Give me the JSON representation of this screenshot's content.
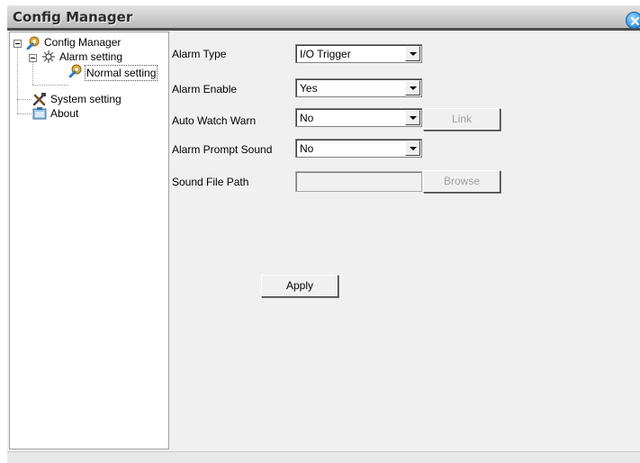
{
  "window": {
    "title": "Config Manager"
  },
  "tree": {
    "root": {
      "label": "Config Manager",
      "icon": "config-manager-icon"
    },
    "alarm_setting": {
      "label": "Alarm setting",
      "icon": "alarm-icon"
    },
    "normal_setting": {
      "label": "Normal setting",
      "icon": "config-gear-icon"
    },
    "system_setting": {
      "label": "System setting",
      "icon": "tools-icon"
    },
    "about": {
      "label": "About",
      "icon": "about-icon"
    }
  },
  "form": {
    "alarm_type": {
      "label": "Alarm Type",
      "value": "I/O Trigger"
    },
    "alarm_enable": {
      "label": "Alarm Enable",
      "value": "Yes"
    },
    "auto_watch_warn": {
      "label": "Auto Watch Warn",
      "value": "No",
      "link_label": "Link"
    },
    "alarm_prompt_sound": {
      "label": "Alarm Prompt Sound",
      "value": "No"
    },
    "sound_file_path": {
      "label": "Sound File Path",
      "value": "",
      "browse_label": "Browse"
    },
    "apply_label": "Apply"
  }
}
